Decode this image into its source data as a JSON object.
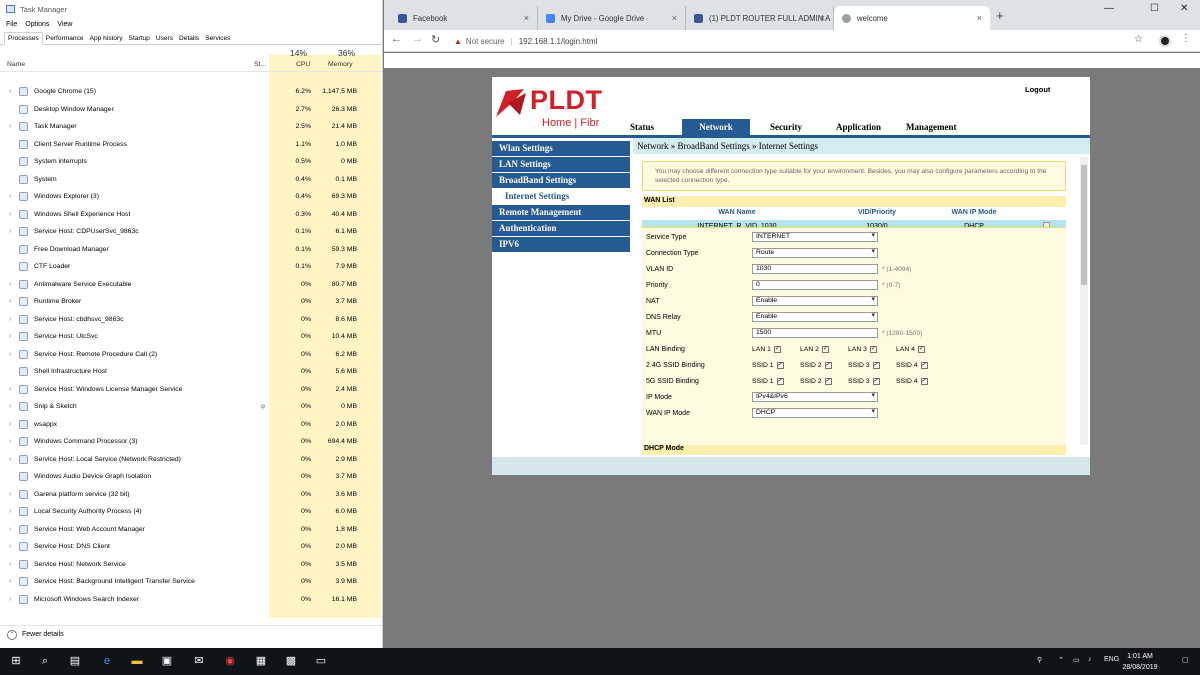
{
  "taskmanager": {
    "title": "Task Manager",
    "menu": [
      "File",
      "Options",
      "View"
    ],
    "tabs": [
      "Processes",
      "Performance",
      "App history",
      "Startup",
      "Users",
      "Details",
      "Services"
    ],
    "columns": {
      "name": "Name",
      "status": "St...",
      "cpu_percent": "14%",
      "cpu": "CPU",
      "mem_percent": "36%",
      "memory": "Memory"
    },
    "processes": [
      {
        "name": "Google Chrome (15)",
        "cpu": "6.2%",
        "mem": "1,147.5 MB",
        "expand": true
      },
      {
        "name": "Desktop Window Manager",
        "cpu": "2.7%",
        "mem": "26.3 MB",
        "expand": false
      },
      {
        "name": "Task Manager",
        "cpu": "2.5%",
        "mem": "21.4 MB",
        "expand": true
      },
      {
        "name": "Client Server Runtime Process",
        "cpu": "1.1%",
        "mem": "1.0 MB",
        "expand": false
      },
      {
        "name": "System interrupts",
        "cpu": "0.5%",
        "mem": "0 MB",
        "expand": false
      },
      {
        "name": "System",
        "cpu": "0.4%",
        "mem": "0.1 MB",
        "expand": false
      },
      {
        "name": "Windows Explorer (3)",
        "cpu": "0.4%",
        "mem": "69.3 MB",
        "expand": true
      },
      {
        "name": "Windows Shell Experience Host",
        "cpu": "0.3%",
        "mem": "40.4 MB",
        "expand": true
      },
      {
        "name": "Service Host: CDPUserSvc_9863c",
        "cpu": "0.1%",
        "mem": "6.1 MB",
        "expand": true
      },
      {
        "name": "Free Download Manager",
        "cpu": "0.1%",
        "mem": "59.3 MB",
        "expand": false
      },
      {
        "name": "CTF Loader",
        "cpu": "0.1%",
        "mem": "7.9 MB",
        "expand": false
      },
      {
        "name": "Antimalware Service Executable",
        "cpu": "0%",
        "mem": "80.7 MB",
        "expand": true
      },
      {
        "name": "Runtime Broker",
        "cpu": "0%",
        "mem": "3.7 MB",
        "expand": true
      },
      {
        "name": "Service Host: cbdhsvc_9863c",
        "cpu": "0%",
        "mem": "8.6 MB",
        "expand": true
      },
      {
        "name": "Service Host: UtcSvc",
        "cpu": "0%",
        "mem": "10.4 MB",
        "expand": true
      },
      {
        "name": "Service Host: Remote Procedure Call (2)",
        "cpu": "0%",
        "mem": "6.2 MB",
        "expand": true
      },
      {
        "name": "Shell Infrastructure Host",
        "cpu": "0%",
        "mem": "5.6 MB",
        "expand": false
      },
      {
        "name": "Service Host: Windows License Manager Service",
        "cpu": "0%",
        "mem": "2.4 MB",
        "expand": true
      },
      {
        "name": "Snip & Sketch",
        "cpu": "0%",
        "mem": "0 MB",
        "expand": true,
        "status": "φ"
      },
      {
        "name": "wsappx",
        "cpu": "0%",
        "mem": "2.0 MB",
        "expand": true
      },
      {
        "name": "Windows Command Processor (3)",
        "cpu": "0%",
        "mem": "694.4 MB",
        "expand": true
      },
      {
        "name": "Service Host: Local Service (Network Restricted)",
        "cpu": "0%",
        "mem": "2.9 MB",
        "expand": true
      },
      {
        "name": "Windows Audio Device Graph Isolation",
        "cpu": "0%",
        "mem": "3.7 MB",
        "expand": false
      },
      {
        "name": "Garena platform service (32 bit)",
        "cpu": "0%",
        "mem": "3.6 MB",
        "expand": true
      },
      {
        "name": "Local Security Authority Process (4)",
        "cpu": "0%",
        "mem": "6.0 MB",
        "expand": true
      },
      {
        "name": "Service Host: Web Account Manager",
        "cpu": "0%",
        "mem": "1.8 MB",
        "expand": true
      },
      {
        "name": "Service Host: DNS Client",
        "cpu": "0%",
        "mem": "2.0 MB",
        "expand": true
      },
      {
        "name": "Service Host: Network Service",
        "cpu": "0%",
        "mem": "3.5 MB",
        "expand": true
      },
      {
        "name": "Service Host: Background Intelligent Transfer Service",
        "cpu": "0%",
        "mem": "3.9 MB",
        "expand": true
      },
      {
        "name": "Microsoft Windows Search Indexer",
        "cpu": "0%",
        "mem": "16.1 MB",
        "expand": true
      }
    ],
    "fewer_details": "Fewer details"
  },
  "chrome": {
    "tabs": [
      {
        "title": "Facebook",
        "color": "#3b5998"
      },
      {
        "title": "My Drive - Google Drive",
        "color": "#4285f4"
      },
      {
        "title": "(1) PLDT ROUTER FULL ADMIN A",
        "color": "#3b5998"
      },
      {
        "title": "welcome",
        "color": "#9aa0a6"
      }
    ],
    "not_secure": "Not secure",
    "url": "192.168.1.1/login.html"
  },
  "router": {
    "brand": "PLDT",
    "brand_sub": "Home | Fibr",
    "logout": "Logout",
    "topnav": [
      "Status",
      "Network",
      "Security",
      "Application",
      "Management"
    ],
    "leftmenu": [
      "Wlan Settings",
      "LAN Settings",
      "BroadBand Settings",
      "Internet Settings",
      "Remote Management",
      "Authentication",
      "IPV6"
    ],
    "breadcrumb": "Network » BroadBand Settings » Internet Settings",
    "info": "You may choose different connection type suitable for your environment. Besides, you may also configure parameters according to the selected connection type.",
    "wan_list_title": "WAN List",
    "wan_headers": [
      "WAN Name",
      "VID/Priority",
      "WAN IP Mode"
    ],
    "wan_row": {
      "name": "INTERNET_R_VID_1030",
      "vid": "1030/0",
      "mode": "DHCP"
    },
    "form": {
      "service_type": {
        "label": "Service Type",
        "value": "INTERNET"
      },
      "connection_type": {
        "label": "Connection Type",
        "value": "Route"
      },
      "vlan_id": {
        "label": "VLAN ID",
        "value": "1030",
        "hint": "* (1-4094)"
      },
      "priority": {
        "label": "Priority",
        "value": "0",
        "hint": "* (0-7)"
      },
      "nat": {
        "label": "NAT",
        "value": "Enable"
      },
      "dns_relay": {
        "label": "DNS Relay",
        "value": "Enable"
      },
      "mtu": {
        "label": "MTU",
        "value": "1500",
        "hint": "* (1280-1500)"
      },
      "lan_binding": {
        "label": "LAN Binding",
        "items": [
          "LAN 1",
          "LAN 2",
          "LAN 3",
          "LAN 4"
        ]
      },
      "ssid24": {
        "label": "2.4G SSID Binding",
        "items": [
          "SSID 1",
          "SSID 2",
          "SSID 3",
          "SSID 4"
        ]
      },
      "ssid5": {
        "label": "5G SSID Binding",
        "items": [
          "SSID 1",
          "SSID 2",
          "SSID 3",
          "SSID 4"
        ]
      },
      "ip_mode": {
        "label": "IP Mode",
        "value": "IPv4&IPv6"
      },
      "wan_ip_mode": {
        "label": "WAN IP Mode",
        "value": "DHCP"
      }
    },
    "dhcp_mode": "DHCP Mode"
  },
  "taskbar": {
    "lang": "ENG",
    "time": "1:01 AM",
    "date": "28/08/2019"
  }
}
